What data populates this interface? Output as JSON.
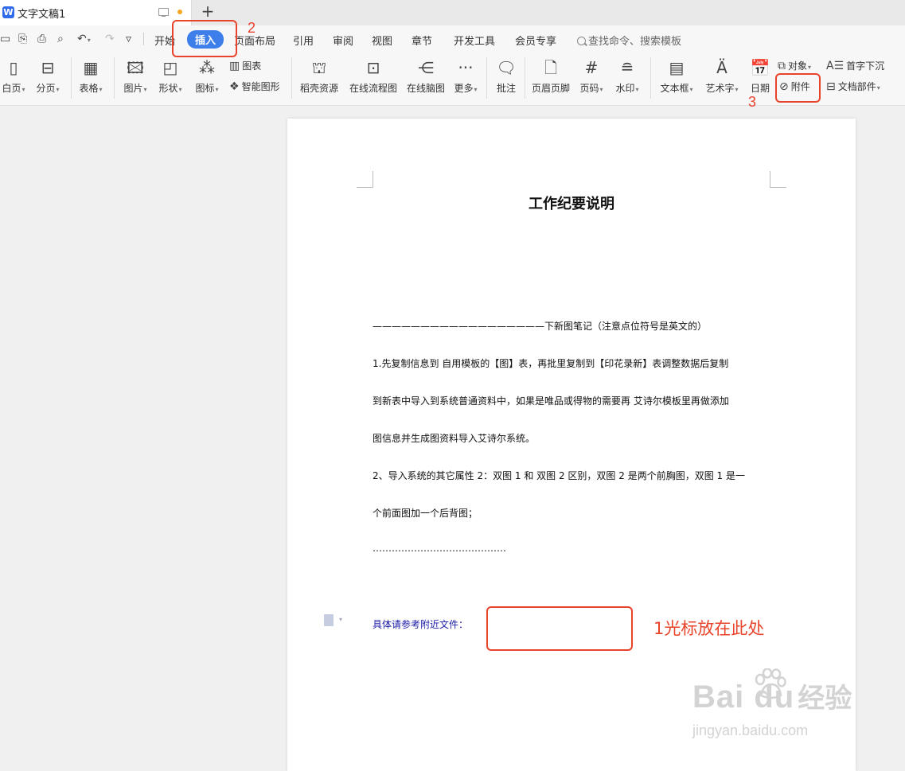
{
  "titlebar": {
    "doc_title": "文字文稿1",
    "new_tab": "+"
  },
  "menu": {
    "tabs": [
      "开始",
      "插入",
      "页面布局",
      "引用",
      "审阅",
      "视图",
      "章节",
      "开发工具",
      "会员专享"
    ],
    "active_tab": "插入",
    "search_placeholder": "查找命令、搜索模板"
  },
  "ribbon": {
    "blank_page": "白页",
    "page_break": "分页",
    "table": "表格",
    "picture": "图片",
    "shape": "形状",
    "icon": "图标",
    "chart": "图表",
    "smart_art": "智能图形",
    "docer_resources": "稻壳资源",
    "online_flowchart": "在线流程图",
    "online_mindmap": "在线脑图",
    "more": "更多",
    "comment": "批注",
    "header_footer": "页眉页脚",
    "page_number": "页码",
    "watermark": "水印",
    "textbox": "文本框",
    "wordart": "艺术字",
    "date": "日期",
    "object": "对象",
    "attachment": "附件",
    "drop_cap": "首字下沉",
    "doc_parts": "文档部件"
  },
  "document": {
    "heading": "工作纪要说明",
    "lines": [
      "——————————————————下新图笔记（注意点位符号是英文的）",
      "1.先复制信息到 自用模板的【图】表，再批里复制到【印花录新】表调整数据后复制",
      "到新表中导入到系统普通资料中，如果是唯品或得物的需要再 艾诗尔模板里再做添加",
      "图信息并生成图资料导入艾诗尔系统。",
      "2、导入系统的其它属性 2：双图 1  和 双图 2 区别，双图 2 是两个前胸图，双图 1 是一",
      "个前面图加一个后背图；",
      "……………………………………"
    ],
    "reference": "具体请参考附近文件："
  },
  "annotations": {
    "step1": "1光标放在此处",
    "step2": "2",
    "step3": "3",
    "color": "#e8432b"
  },
  "watermark": {
    "brand": "Bai  du",
    "brand_cn": "经验",
    "url": "jingyan.baidu.com"
  },
  "colors": {
    "accent": "#3d7eea",
    "annotation": "#e8432b",
    "reference_text": "#1a1aa6"
  }
}
